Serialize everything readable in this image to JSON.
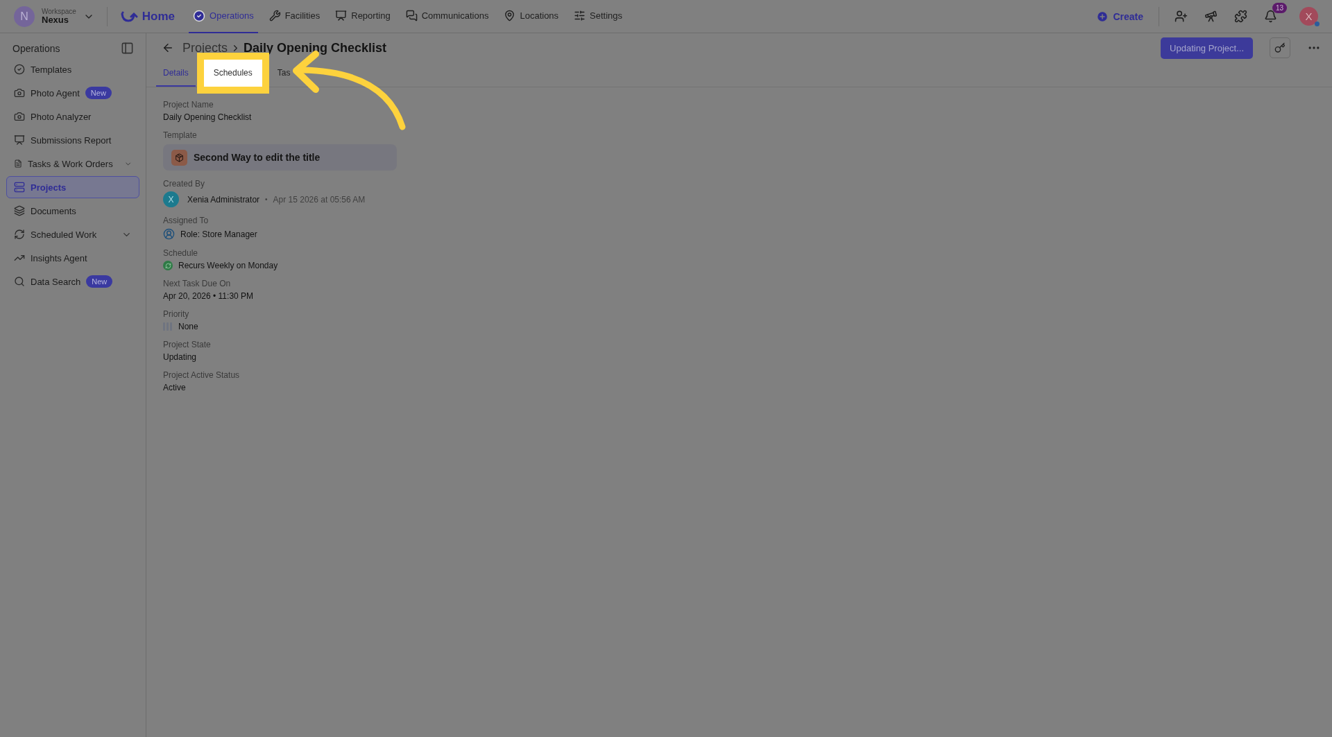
{
  "topbar": {
    "workspace": {
      "initial": "N",
      "label": "Workspace",
      "name": "Nexus"
    },
    "home": "Home",
    "nav": [
      {
        "label": "Operations",
        "selected": true
      },
      {
        "label": "Facilities",
        "selected": false
      },
      {
        "label": "Reporting",
        "selected": false
      },
      {
        "label": "Communications",
        "selected": false
      },
      {
        "label": "Locations",
        "selected": false
      },
      {
        "label": "Settings",
        "selected": false
      }
    ],
    "create": "Create",
    "notifications": "13",
    "avatar": "X"
  },
  "sidebar": {
    "title": "Operations",
    "items": [
      {
        "label": "Templates",
        "selected": false,
        "submenu": false
      },
      {
        "label": "Photo Agent",
        "badge": "New",
        "selected": false,
        "submenu": false
      },
      {
        "label": "Photo Analyzer",
        "selected": false,
        "submenu": false
      },
      {
        "label": "Submissions Report",
        "selected": false,
        "submenu": false
      },
      {
        "label": "Tasks & Work Orders",
        "selected": false,
        "submenu": true
      },
      {
        "label": "Projects",
        "selected": true,
        "submenu": false
      },
      {
        "label": "Documents",
        "selected": false,
        "submenu": false
      },
      {
        "label": "Scheduled Work",
        "selected": false,
        "submenu": true
      },
      {
        "label": "Insights Agent",
        "selected": false,
        "submenu": false
      },
      {
        "label": "Data Search",
        "badge": "New",
        "selected": false,
        "submenu": false
      }
    ]
  },
  "page": {
    "breadcrumb": [
      "Projects",
      "Daily Opening Checklist"
    ],
    "action_button": "Updating Project...",
    "tabs": [
      {
        "label": "Details",
        "selected": true,
        "highlighted": false
      },
      {
        "label": "Schedules",
        "selected": false,
        "highlighted": true
      },
      {
        "label": "Tas",
        "selected": false,
        "highlighted": false
      }
    ],
    "fields": [
      {
        "kind": "text",
        "label": "Project Name",
        "value": "Daily Opening Checklist"
      },
      {
        "kind": "template",
        "label": "Template",
        "value": "Second Way to edit the title"
      },
      {
        "kind": "user",
        "label": "Created By",
        "initial": "X",
        "value": "Xenia Administrator",
        "separator": "•",
        "meta": "Apr 15 2026 at 05:56 AM"
      },
      {
        "kind": "role",
        "label": "Assigned To",
        "value": "Role: Store Manager"
      },
      {
        "kind": "schedule",
        "label": "Schedule",
        "value": "Recurs Weekly on Monday"
      },
      {
        "kind": "text",
        "label": "Next Task Due On",
        "value": "Apr 20, 2026 • 11:30 PM"
      },
      {
        "kind": "priority",
        "label": "Priority",
        "value": "None"
      },
      {
        "kind": "text",
        "label": "Project State",
        "value": "Updating"
      },
      {
        "kind": "text",
        "label": "Project Active Status",
        "value": "Active"
      }
    ]
  }
}
